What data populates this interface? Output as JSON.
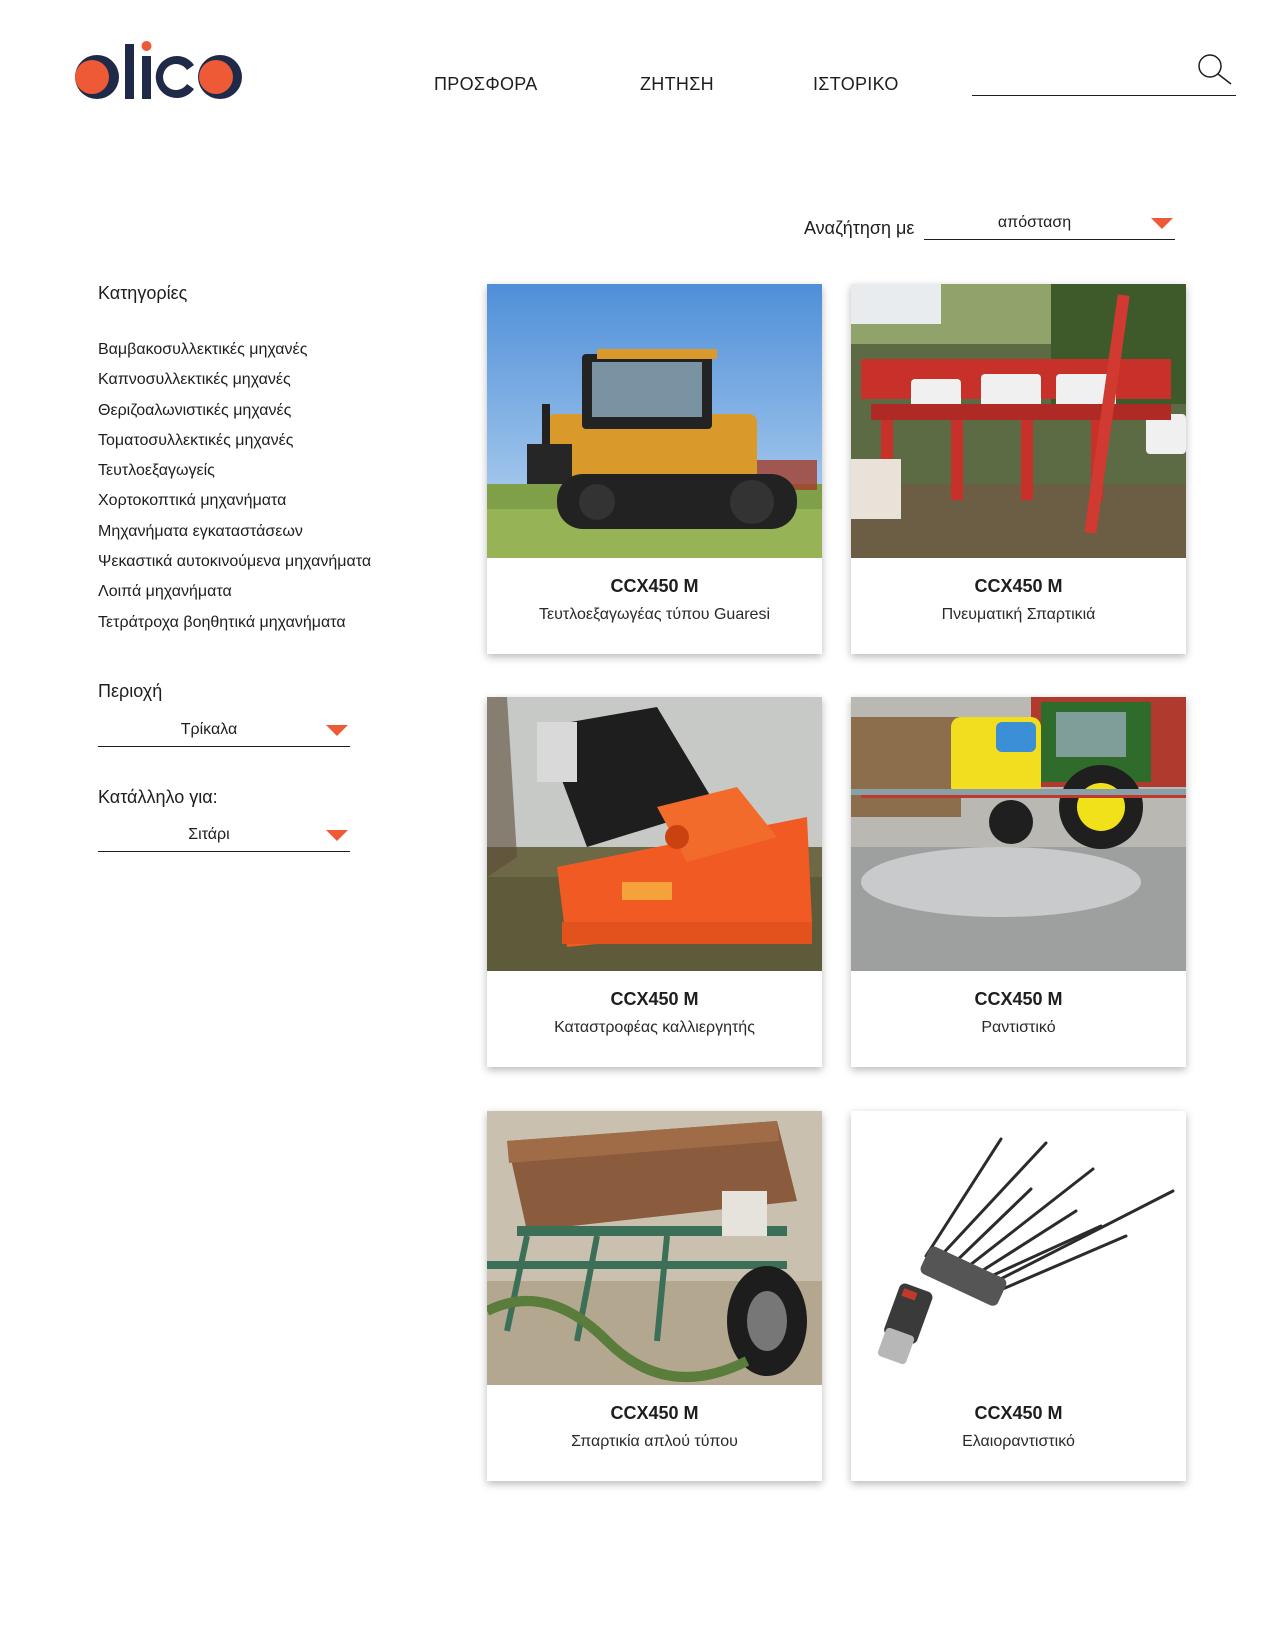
{
  "brand": {
    "name": "olico",
    "accent_color": "#ee5a36",
    "dark_color": "#1f2a48"
  },
  "nav": {
    "items": [
      {
        "label": "ΠΡΟΣΦΟΡΑ"
      },
      {
        "label": "ΖΗΤΗΣΗ"
      },
      {
        "label": "ΙΣΤΟΡΙΚΟ"
      }
    ]
  },
  "search": {
    "value": "",
    "icon": "search-icon"
  },
  "sort": {
    "label": "Αναζήτηση με",
    "selected": "απόσταση"
  },
  "sidebar": {
    "categories_heading": "Κατηγορίες",
    "categories": [
      "Βαμβακοσυλλεκτικές μηχανές",
      "Καπνοσυλλεκτικές μηχανές",
      "Θεριζοαλωνιστικές μηχανές",
      "Τοματοσυλλεκτικές μηχανές",
      "Τευτλοεξαγωγείς",
      "Χορτοκοπτικά μηχανήματα",
      "Μηχανήματα εγκαταστάσεων",
      "Ψεκαστικά αυτοκινούμενα μηχανήματα",
      "Λοιπά μηχανήματα",
      "Τετράτροχα βοηθητικά μηχανήματα"
    ],
    "region": {
      "label": "Περιοχή",
      "selected": "Τρίκαλα"
    },
    "suitable": {
      "label": "Κατάλληλο για:",
      "selected": "Σιτάρι"
    }
  },
  "products": [
    {
      "title": "CCX450 M",
      "subtitle": "Τευτλοεξαγωγέας τύπου Guaresi",
      "image": "tracked-tractor"
    },
    {
      "title": "CCX450 M",
      "subtitle": "Πνευματική Σπαρτικιά",
      "image": "pneumatic-seeder"
    },
    {
      "title": "CCX450 M",
      "subtitle": "Καταστροφέας καλλιεργητής",
      "image": "orange-mulcher"
    },
    {
      "title": "CCX450 M",
      "subtitle": "Ραντιστικό",
      "image": "tractor-sprayer"
    },
    {
      "title": "CCX450 M",
      "subtitle": "Σπαρτικία απλού τύπου",
      "image": "old-seed-drill"
    },
    {
      "title": "CCX450 M",
      "subtitle": "Ελαιοραντιστικό",
      "image": "olive-harvester-tool"
    }
  ]
}
